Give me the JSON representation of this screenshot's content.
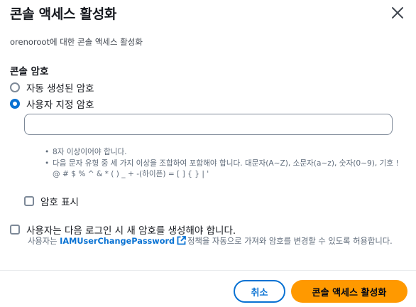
{
  "modal": {
    "title": "콘솔 액세스 활성화",
    "subtitle": "orenoroot에 대한 콘솔 액세스 활성화"
  },
  "password": {
    "section_label": "콘솔 암호",
    "option_auto": "자동 생성된 암호",
    "option_custom": "사용자 지정 암호",
    "selected": "custom",
    "input_value": "",
    "hints": [
      "8자 이상이어야 합니다.",
      "다음 문자 유형 중 세 가지 이상을 조합하여 포함해야 합니다. 대문자(A~Z), 소문자(a~z), 숫자(0~9), 기호 ! @ # $ % ^ & * ( ) _ + -(하이픈) = [ ] { } | '"
    ],
    "show_password_label": "암호 표시",
    "show_password_checked": false
  },
  "reset": {
    "label": "사용자는 다음 로그인 시 새 암호를 생성해야 합니다.",
    "checked": false,
    "desc_prefix": "사용자는",
    "link_text": "IAMUserChangePassword",
    "desc_suffix": "정책을 자동으로 가져와 암호를 변경할 수 있도록 허용합니다."
  },
  "footer": {
    "cancel_label": "취소",
    "confirm_label": "콘솔 액세스 활성화"
  },
  "colors": {
    "accent": "#0972d3",
    "primary_button": "#ff9900"
  },
  "icons": {
    "close": "close-icon",
    "external": "external-link-icon"
  }
}
